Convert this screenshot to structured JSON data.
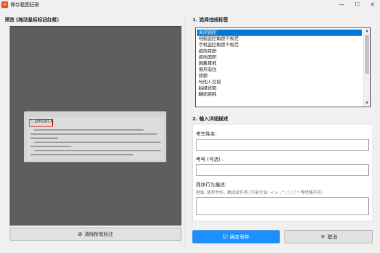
{
  "window": {
    "title": "保存截图记录",
    "app_icon": "app-icon",
    "minimize": "—",
    "maximize": "☐",
    "close": "✕"
  },
  "preview": {
    "label": "预览 (拖动鼠标标记红框)",
    "doc_first_line": "1. 自考记录工具"
  },
  "section1": {
    "title": "1. 选择违规标签",
    "items": [
      "关闭监控",
      "电脑监控角度不规范",
      "手机监控角度不规范",
      "遮挡耳部",
      "遮挡面部",
      "佩戴耳机",
      "离开座位",
      "读题",
      "与他人交谈",
      "拍摄试题",
      "翻阅资料"
    ],
    "selected_index": 0
  },
  "section2": {
    "title": "2. 输入详细描述",
    "name_label": "考生姓名:",
    "name_value": "",
    "id_label": "考号 (可选) :",
    "id_value": "",
    "desc_label": "具体行为描述:",
    "desc_hint": "例如: 使用手机、翻阅资料等 (不能包含: < > : \" / \\ | ? * 等特殊符号)",
    "desc_value": ""
  },
  "buttons": {
    "clear": "清除所有标注",
    "save": "确定保存",
    "cancel": "取消"
  },
  "icons": {
    "clear": "no-entry-icon",
    "save": "save-check-icon",
    "cancel": "close-icon"
  },
  "colors": {
    "selection": "#0078d7",
    "save_button": "#1e8fff",
    "mark_box": "#d21414",
    "preview_bg": "#5e5e5e"
  }
}
